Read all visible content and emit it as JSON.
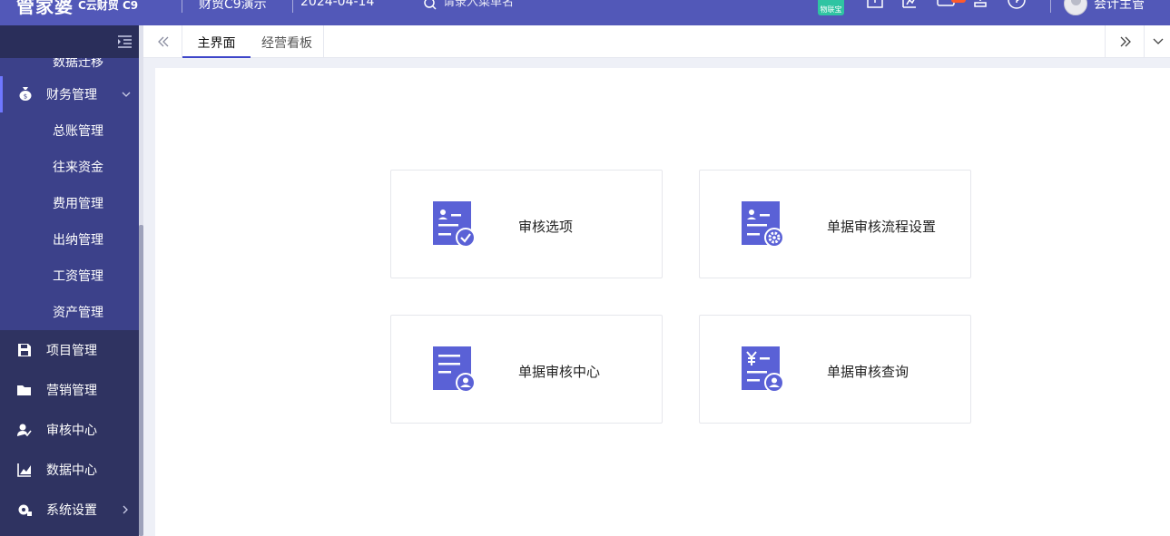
{
  "topbar": {
    "logo": "管家婆",
    "logo_sub": "C云财贸 C9",
    "company": "财贸C9演示",
    "date": "2024-04-14",
    "search_placeholder": "请录入菜单名",
    "app_badge": "物联宝",
    "icons": [
      "calendar-icon",
      "report-icon",
      "message-icon",
      "stamp-icon",
      "help-icon"
    ],
    "username": "会计主管",
    "accent_color": "#5258b8"
  },
  "sidebar": {
    "partial_item": "数据迁移",
    "group": {
      "label": "财务管理",
      "icon": "money-bag-icon",
      "items": [
        "总账管理",
        "往来资金",
        "费用管理",
        "出纳管理",
        "工资管理",
        "资产管理"
      ]
    },
    "items": [
      {
        "label": "项目管理",
        "icon": "save-icon"
      },
      {
        "label": "营销管理",
        "icon": "folder-icon"
      },
      {
        "label": "审核中心",
        "icon": "audit-icon"
      },
      {
        "label": "数据中心",
        "icon": "chart-icon"
      },
      {
        "label": "系统设置",
        "icon": "settings-icon"
      }
    ]
  },
  "tabs": {
    "items": [
      "主界面",
      "经营看板"
    ],
    "active": 0
  },
  "cards": [
    {
      "label": "审核选项",
      "icon": "audit-check-icon"
    },
    {
      "label": "单据审核流程设置",
      "icon": "audit-settings-icon"
    },
    {
      "label": "单据审核中心",
      "icon": "document-user-icon"
    },
    {
      "label": "单据审核查询",
      "icon": "voucher-user-icon"
    }
  ],
  "colors": {
    "sidebar_bg": "#2f3361",
    "sidebar_active": "#3c418a",
    "card_icon": "#5a61d6"
  }
}
